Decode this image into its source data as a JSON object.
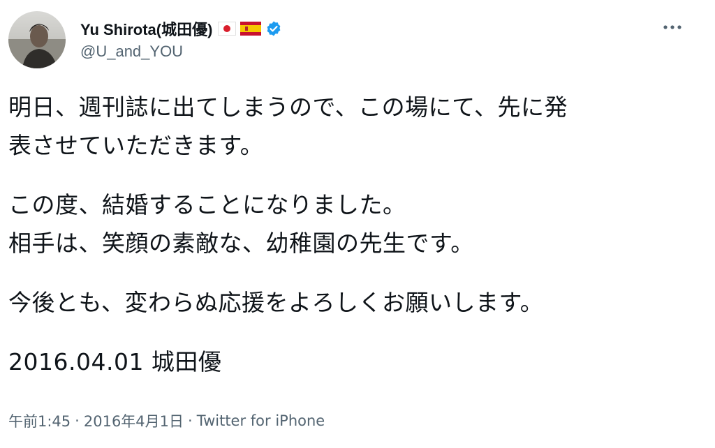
{
  "user": {
    "display_name": "Yu Shirota(城田優)",
    "handle": "@U_and_YOU",
    "badges": [
      "japan-flag-icon",
      "spain-flag-icon",
      "verified-badge-icon"
    ],
    "verified_color": "#1d9bf0"
  },
  "tweet": {
    "lines": [
      "明日、週刊誌に出てしまうので、この場にて、先に発",
      "表させていただきます。",
      "この度、結婚することになりました。",
      "相手は、笑顔の素敵な、幼稚園の先生です。",
      "今後とも、変わらぬ応援をよろしくお願いします。",
      "2016.04.01  城田優"
    ],
    "time": "午前1:45",
    "separator": "·",
    "date": "2016年4月1日",
    "source": "Twitter for iPhone"
  },
  "icons": {
    "more": "more-horizontal-icon"
  },
  "colors": {
    "text_primary": "#0f1419",
    "text_secondary": "#536471",
    "background": "#ffffff"
  }
}
